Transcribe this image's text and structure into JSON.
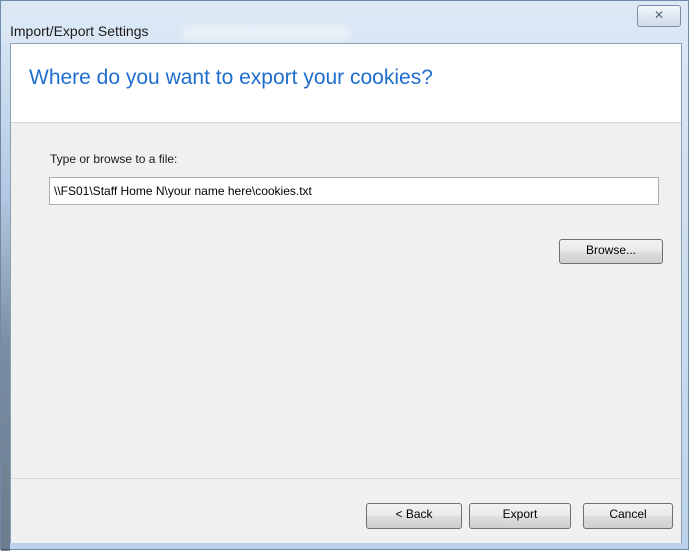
{
  "window": {
    "title": "Import/Export Settings",
    "close_glyph": "✕"
  },
  "header": {
    "heading": "Where do you want to export your cookies?"
  },
  "form": {
    "label": "Type or browse to a file:",
    "path_value": "\\\\FS01\\Staff Home N\\your name here\\cookies.txt",
    "browse_label": "Browse..."
  },
  "footer": {
    "back_label": "< Back",
    "export_label": "Export",
    "cancel_label": "Cancel"
  },
  "colors": {
    "heading": "#1f6ecf",
    "frame": "#c9dbee",
    "body": "#f0f0f0"
  }
}
